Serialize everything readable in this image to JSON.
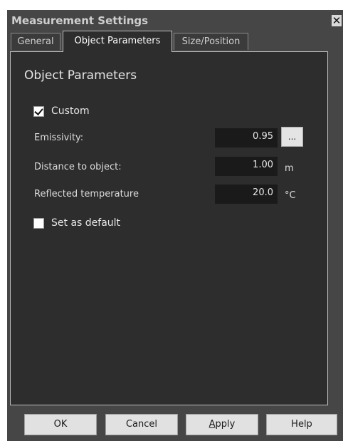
{
  "window": {
    "title": "Measurement Settings",
    "close_glyph": "✕"
  },
  "tabs": [
    {
      "label": "General",
      "active": false
    },
    {
      "label": "Object Parameters",
      "active": true
    },
    {
      "label": "Size/Position",
      "active": false
    }
  ],
  "panel": {
    "group_title": "Object Parameters",
    "custom": {
      "label": "Custom",
      "checked": true
    },
    "emissivity": {
      "label": "Emissivity:",
      "value": "0.95",
      "browse_label": "..."
    },
    "distance": {
      "label": "Distance to object:",
      "value": "1.00",
      "unit": "m"
    },
    "reflected": {
      "label": "Reflected temperature",
      "value": "20.0",
      "unit": "°C"
    },
    "set_default": {
      "label": "Set as default",
      "checked": false
    }
  },
  "buttons": {
    "ok": "OK",
    "cancel": "Cancel",
    "apply_mnemonic": "A",
    "apply_rest": "pply",
    "help": "Help"
  },
  "icons": {
    "close": "close-icon",
    "checkmark": "checkmark-icon"
  },
  "colors": {
    "window_bg": "#464646",
    "panel_bg": "#2d2d2d",
    "field_bg": "#1a1a1a",
    "button_bg": "#e1e1e1"
  }
}
